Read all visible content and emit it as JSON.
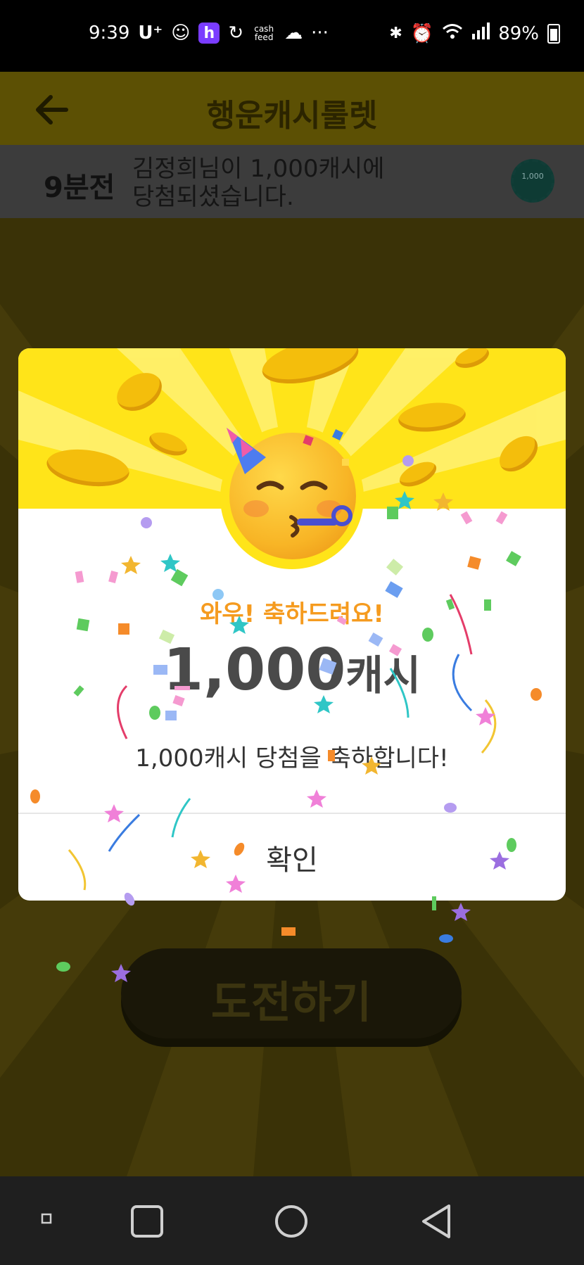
{
  "status_bar": {
    "time": "9:39",
    "carrier": "U⁺",
    "app_h": "h",
    "cash_feed": "cash feed",
    "more": "···",
    "battery": "89%"
  },
  "header": {
    "title": "행운캐시룰렛"
  },
  "ticker": {
    "time_ago": "9분전",
    "line1": "김정희님이 1,000캐시에",
    "line2": "당첨되셨습니다.",
    "coin_label": "1,000"
  },
  "challenge_button": {
    "label": "도전하기"
  },
  "modal": {
    "congrats": "와우! 축하드려요!",
    "amount": "1,000",
    "unit": "캐시",
    "description": "1,000캐시 당첨을 축하합니다!",
    "confirm_label": "확인"
  },
  "colors": {
    "accent_yellow": "#ffe419",
    "congrats_orange": "#f59b1f",
    "amount_text": "#4a4a4a"
  }
}
